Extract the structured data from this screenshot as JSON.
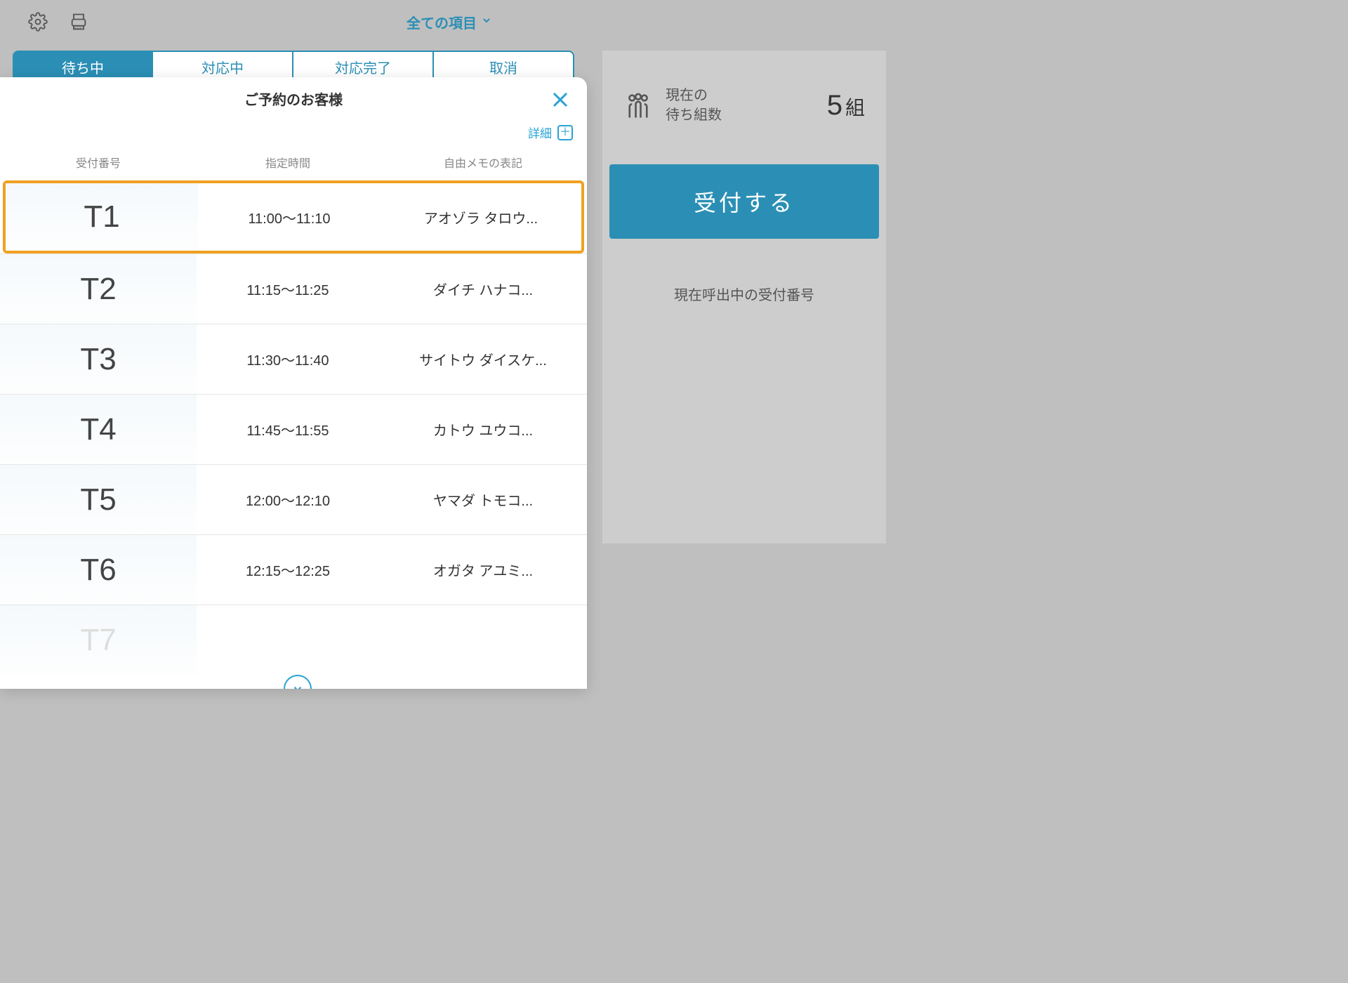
{
  "header": {
    "filter_label": "全ての項目"
  },
  "tabs": [
    "待ち中",
    "対応中",
    "対応完了",
    "取消"
  ],
  "right": {
    "waiting_label_1": "現在の",
    "waiting_label_2": "待ち組数",
    "waiting_count": "5",
    "waiting_unit": "組",
    "checkin_label": "受付する",
    "calling_label": "現在呼出中の受付番号"
  },
  "modal": {
    "title": "ご予約のお客様",
    "detail_label": "詳細",
    "columns": {
      "id": "受付番号",
      "time": "指定時間",
      "memo": "自由メモの表記"
    },
    "rows": [
      {
        "id": "T1",
        "time": "11:00～11:10",
        "memo": "アオゾラ タロウ...",
        "highlight": true
      },
      {
        "id": "T2",
        "time": "11:15～11:25",
        "memo": "ダイチ ハナコ..."
      },
      {
        "id": "T3",
        "time": "11:30～11:40",
        "memo": "サイトウ ダイスケ..."
      },
      {
        "id": "T4",
        "time": "11:45～11:55",
        "memo": "カトウ ユウコ..."
      },
      {
        "id": "T5",
        "time": "12:00～12:10",
        "memo": "ヤマダ トモコ..."
      },
      {
        "id": "T6",
        "time": "12:15～12:25",
        "memo": "オガタ アユミ..."
      },
      {
        "id": "T7",
        "time": "",
        "memo": "",
        "faded": true
      }
    ]
  }
}
